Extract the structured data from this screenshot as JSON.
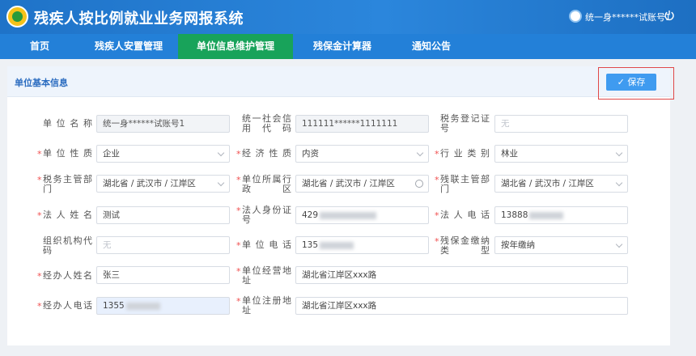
{
  "header": {
    "title": "残疾人按比例就业业务网报系统",
    "user_name": "统一身******试账号1"
  },
  "nav": {
    "items": [
      "首页",
      "残疾人安置管理",
      "单位信息维护管理",
      "残保金计算器",
      "通知公告"
    ],
    "active_index": 2
  },
  "card": {
    "title": "单位基本信息",
    "save_label": "保存"
  },
  "form": {
    "unit_name": {
      "label": "单位名称",
      "value": "统一身******试账号1",
      "required": false
    },
    "credit_code": {
      "label": "统一社会信用代码",
      "value": "111111******1111111",
      "required": false
    },
    "tax_reg": {
      "label": "税务登记证号",
      "placeholder": "无",
      "required": false
    },
    "unit_nature": {
      "label": "单位性质",
      "value": "企业",
      "required": true
    },
    "econ_nature": {
      "label": "经济性质",
      "value": "内资",
      "required": true
    },
    "industry": {
      "label": "行业类别",
      "value": "林业",
      "required": true
    },
    "tax_dept": {
      "label": "税务主管部门",
      "value": "湖北省 / 武汉市 / 江岸区",
      "required": true
    },
    "unit_region": {
      "label": "单位所属行政区",
      "value": "湖北省 / 武汉市 / 江岸区",
      "required": true
    },
    "disab_dept": {
      "label": "残联主管部门",
      "value": "湖北省 / 武汉市 / 江岸区",
      "required": true
    },
    "legal_name": {
      "label": "法人姓名",
      "value": "测试",
      "required": true
    },
    "legal_id": {
      "label": "法人身份证号",
      "value": "429",
      "required": true
    },
    "legal_phone": {
      "label": "法人电话",
      "value": "13888",
      "required": true
    },
    "org_code": {
      "label": "组织机构代码",
      "placeholder": "无",
      "required": false
    },
    "unit_phone": {
      "label": "单位电话",
      "value": "135",
      "required": true
    },
    "pay_type": {
      "label": "残保金缴纳类型",
      "value": "按年缴纳",
      "required": true
    },
    "agent_name": {
      "label": "经办人姓名",
      "value": "张三",
      "required": true
    },
    "biz_addr": {
      "label": "单位经营地址",
      "value": "湖北省江岸区xxx路",
      "required": true
    },
    "agent_phone": {
      "label": "经办人电话",
      "value": "1355",
      "required": true
    },
    "reg_addr": {
      "label": "单位注册地址",
      "value": "湖北省江岸区xxx路",
      "required": true
    }
  }
}
